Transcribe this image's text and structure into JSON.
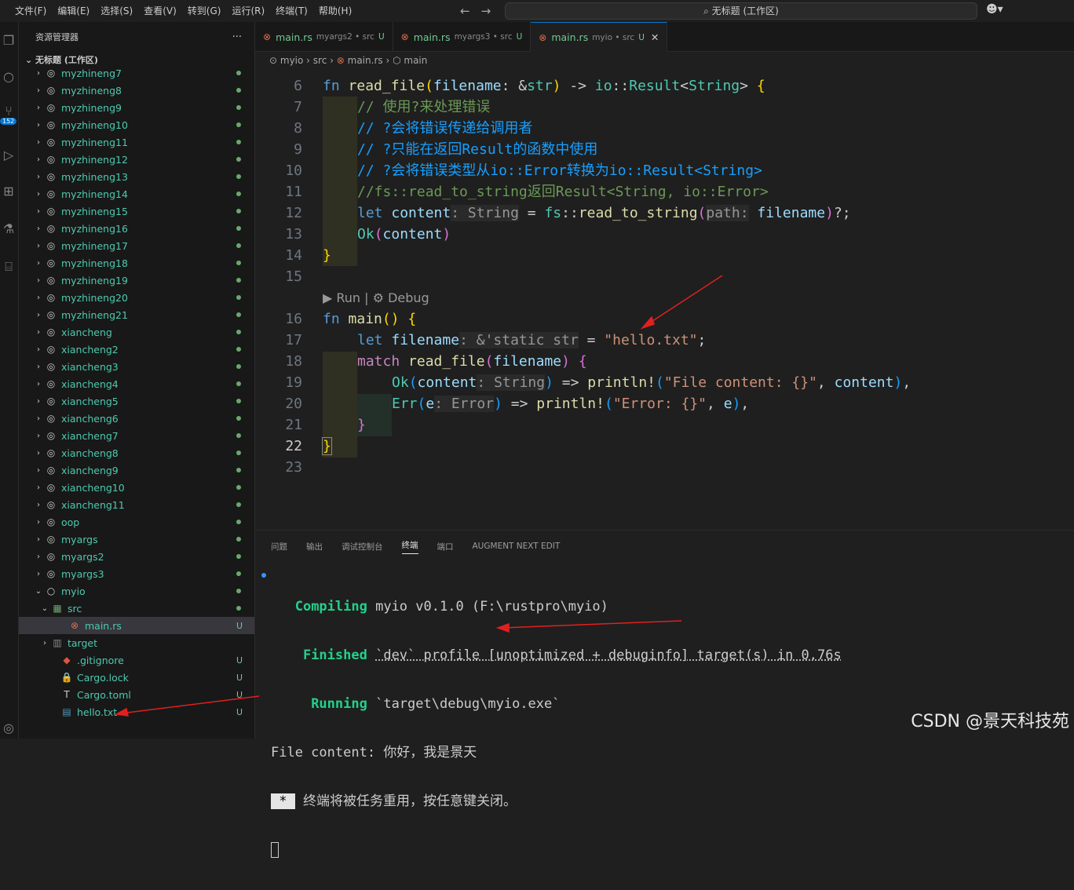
{
  "menu": [
    "文件(F)",
    "编辑(E)",
    "选择(S)",
    "查看(V)",
    "转到(G)",
    "运行(R)",
    "终端(T)",
    "帮助(H)"
  ],
  "search": {
    "text": "无标题 (工作区)"
  },
  "activity_badge": "152",
  "sidebar": {
    "title": "资源管理器",
    "more": "···",
    "workspace": "无标题 (工作区)",
    "items": [
      {
        "label": "myzhineng7",
        "kind": "folder"
      },
      {
        "label": "myzhineng8",
        "kind": "folder"
      },
      {
        "label": "myzhineng9",
        "kind": "folder"
      },
      {
        "label": "myzhineng10",
        "kind": "folder"
      },
      {
        "label": "myzhineng11",
        "kind": "folder"
      },
      {
        "label": "myzhineng12",
        "kind": "folder"
      },
      {
        "label": "myzhineng13",
        "kind": "folder"
      },
      {
        "label": "myzhineng14",
        "kind": "folder"
      },
      {
        "label": "myzhineng15",
        "kind": "folder"
      },
      {
        "label": "myzhineng16",
        "kind": "folder"
      },
      {
        "label": "myzhineng17",
        "kind": "folder"
      },
      {
        "label": "myzhineng18",
        "kind": "folder"
      },
      {
        "label": "myzhineng19",
        "kind": "folder"
      },
      {
        "label": "myzhineng20",
        "kind": "folder"
      },
      {
        "label": "myzhineng21",
        "kind": "folder"
      },
      {
        "label": "xiancheng",
        "kind": "folder"
      },
      {
        "label": "xiancheng2",
        "kind": "folder"
      },
      {
        "label": "xiancheng3",
        "kind": "folder"
      },
      {
        "label": "xiancheng4",
        "kind": "folder"
      },
      {
        "label": "xiancheng5",
        "kind": "folder"
      },
      {
        "label": "xiancheng6",
        "kind": "folder"
      },
      {
        "label": "xiancheng7",
        "kind": "folder"
      },
      {
        "label": "xiancheng8",
        "kind": "folder"
      },
      {
        "label": "xiancheng9",
        "kind": "folder"
      },
      {
        "label": "xiancheng10",
        "kind": "folder"
      },
      {
        "label": "xiancheng11",
        "kind": "folder"
      },
      {
        "label": "oop",
        "kind": "folder"
      },
      {
        "label": "myargs",
        "kind": "folder"
      },
      {
        "label": "myargs2",
        "kind": "folder"
      },
      {
        "label": "myargs3",
        "kind": "folder"
      },
      {
        "label": "myio",
        "kind": "folder-open"
      },
      {
        "label": "src",
        "kind": "src-open"
      },
      {
        "label": "main.rs",
        "kind": "rust-file",
        "status": "U",
        "selected": true
      },
      {
        "label": "target",
        "kind": "target"
      },
      {
        "label": ".gitignore",
        "kind": "git-file",
        "status": "U"
      },
      {
        "label": "Cargo.lock",
        "kind": "lock-file",
        "status": "U"
      },
      {
        "label": "Cargo.toml",
        "kind": "toml-file",
        "status": "U"
      },
      {
        "label": "hello.txt",
        "kind": "text-file",
        "status": "U"
      }
    ]
  },
  "tabs": [
    {
      "name": "main.rs",
      "desc": "myargs2 • src",
      "status": "U"
    },
    {
      "name": "main.rs",
      "desc": "myargs3 • src",
      "status": "U"
    },
    {
      "name": "main.rs",
      "desc": "myio • src",
      "status": "U",
      "active": true
    }
  ],
  "breadcrumb": [
    "myio",
    "src",
    "main.rs",
    "main"
  ],
  "code": {
    "line_numbers": [
      "6",
      "7",
      "8",
      "9",
      "10",
      "11",
      "12",
      "13",
      "14",
      "15",
      "",
      "16",
      "17",
      "18",
      "19",
      "20",
      "21",
      "22",
      "23"
    ],
    "comments": [
      "// 使用?来处理错误",
      "// ?会将错误传递给调用者",
      "// ?只能在返回Result的函数中使用",
      "// ?会将错误类型从io::Error转换为io::Result<String>",
      "//fs::read_to_string返回Result<String, io::Error>"
    ],
    "run_lens": "Run",
    "debug_lens": "Debug",
    "string_literal": "\"hello.txt\""
  },
  "panel": {
    "tabs": [
      "问题",
      "输出",
      "调试控制台",
      "终端",
      "端口",
      "AUGMENT NEXT EDIT"
    ],
    "active_tab": "终端",
    "compiling_label": "Compiling",
    "compiling_text": "myio v0.1.0 (F:\\rustpro\\myio)",
    "finished_label": "Finished",
    "finished_text": "`dev` profile [unoptimized + debuginfo] target(s) in 0.76s",
    "running_label": "Running",
    "running_text": "`target\\debug\\myio.exe`",
    "output": "File content: 你好，我是景天",
    "reuse_marker": " * ",
    "reuse_text": "终端将被任务重用，按任意键关闭。"
  },
  "watermark": "CSDN @景天科技苑"
}
